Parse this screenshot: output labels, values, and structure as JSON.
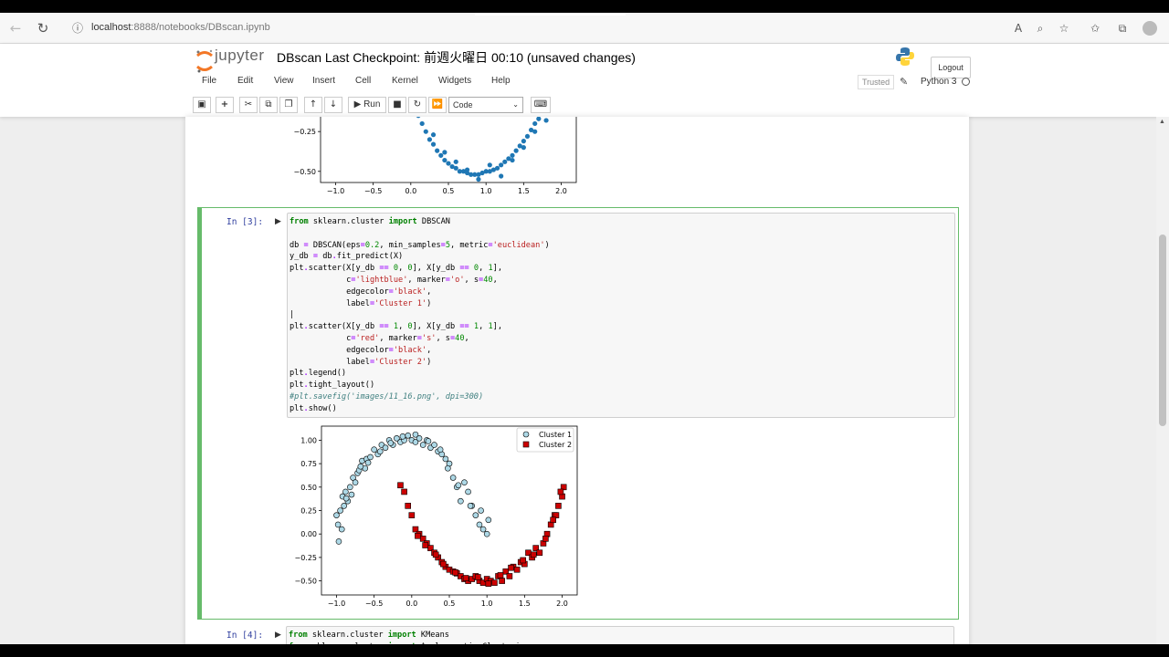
{
  "browser": {
    "url_host": "localhost",
    "url_rest": ":8888/notebooks/DBscan.ipynb"
  },
  "header": {
    "logo_text": "jupyter",
    "notebook_title": "DBscan Last Checkpoint: 前週火曜日 00:10  (unsaved changes)",
    "logout_label": "Logout",
    "trusted_label": "Trusted",
    "kernel_name": "Python 3"
  },
  "menu": {
    "items": [
      "File",
      "Edit",
      "View",
      "Insert",
      "Cell",
      "Kernel",
      "Widgets",
      "Help"
    ]
  },
  "toolbar": {
    "run_label": "Run",
    "cell_type": "Code"
  },
  "cells": {
    "cell3_prompt": "In [3]:",
    "cell4_prompt": "In [4]:",
    "cell4_line1": "from sklearn.cluster import KMeans",
    "cell4_line2": "from sklearn.cluster import AgglomerativeClustering"
  },
  "colors": {
    "accent_green": "#66bb6a",
    "prompt_blue": "#303f9f",
    "point_blue": "#1f77b4",
    "cluster1_fill": "#add8e6",
    "cluster2_fill": "#cc0000"
  },
  "chart_data": [
    {
      "type": "scatter",
      "xticks": [
        "−1.0",
        "−0.5",
        "0.0",
        "0.5",
        "1.0",
        "1.5",
        "2.0"
      ],
      "yticks": [
        "−0.25",
        "−0.50"
      ],
      "xlim": [
        -1.2,
        2.2
      ],
      "ylim": [
        -0.57,
        -0.1
      ],
      "note": "partially visible output of previous cell (lower moon)",
      "series": [
        {
          "color": "#1f77b4",
          "x": [
            0.1,
            0.15,
            0.2,
            0.25,
            0.3,
            0.35,
            0.4,
            0.45,
            0.5,
            0.55,
            0.6,
            0.65,
            0.7,
            0.75,
            0.8,
            0.85,
            0.9,
            0.95,
            1.0,
            1.05,
            1.1,
            1.15,
            1.2,
            1.25,
            1.3,
            1.35,
            1.4,
            1.45,
            1.5,
            1.55,
            1.6,
            1.65,
            1.7,
            1.75,
            1.8,
            1.85,
            1.9,
            0.3,
            0.45,
            0.6,
            0.75,
            0.9,
            1.05,
            1.2,
            1.35,
            1.5,
            1.65,
            1.8
          ],
          "y": [
            -0.15,
            -0.2,
            -0.25,
            -0.3,
            -0.33,
            -0.37,
            -0.4,
            -0.43,
            -0.45,
            -0.47,
            -0.48,
            -0.5,
            -0.5,
            -0.51,
            -0.52,
            -0.52,
            -0.52,
            -0.51,
            -0.5,
            -0.5,
            -0.49,
            -0.48,
            -0.46,
            -0.44,
            -0.42,
            -0.4,
            -0.37,
            -0.34,
            -0.31,
            -0.28,
            -0.24,
            -0.2,
            -0.17,
            -0.14,
            -0.12,
            -0.13,
            -0.11,
            -0.27,
            -0.38,
            -0.44,
            -0.49,
            -0.55,
            -0.46,
            -0.53,
            -0.43,
            -0.35,
            -0.25,
            -0.18
          ]
        }
      ]
    },
    {
      "type": "scatter",
      "xticks": [
        "−1.0",
        "−0.5",
        "0.0",
        "0.5",
        "1.0",
        "1.5",
        "2.0"
      ],
      "yticks": [
        "1.00",
        "0.75",
        "0.50",
        "0.25",
        "0.00",
        "−0.25",
        "−0.50"
      ],
      "xlim": [
        -1.2,
        2.2
      ],
      "ylim": [
        -0.65,
        1.15
      ],
      "legend": "top-right",
      "series": [
        {
          "name": "Cluster 1",
          "marker": "o",
          "color": "#add8e6",
          "x": [
            -1.0,
            -0.98,
            -0.95,
            -0.97,
            -0.92,
            -0.9,
            -0.88,
            -0.85,
            -0.82,
            -0.8,
            -0.78,
            -0.75,
            -0.72,
            -0.7,
            -0.66,
            -0.62,
            -0.6,
            -0.55,
            -0.5,
            -0.45,
            -0.4,
            -0.35,
            -0.3,
            -0.25,
            -0.2,
            -0.15,
            -0.1,
            -0.05,
            0.0,
            0.05,
            0.1,
            0.15,
            0.2,
            0.25,
            0.3,
            0.35,
            0.4,
            0.45,
            0.5,
            0.55,
            0.6,
            0.65,
            0.7,
            0.75,
            0.8,
            0.85,
            0.9,
            0.95,
            1.0,
            1.02,
            -0.93,
            -0.87,
            -0.68,
            -0.58,
            -0.42,
            -0.28,
            -0.12,
            0.05,
            0.22,
            0.38,
            0.48,
            0.62,
            0.78,
            0.92
          ],
          "y": [
            0.2,
            0.1,
            0.25,
            -0.08,
            0.4,
            0.3,
            0.45,
            0.35,
            0.5,
            0.42,
            0.6,
            0.55,
            0.65,
            0.68,
            0.78,
            0.7,
            0.8,
            0.82,
            0.9,
            0.85,
            0.95,
            0.92,
            1.0,
            0.95,
            1.02,
            0.98,
            1.0,
            1.05,
            1.0,
            0.98,
            1.02,
            0.95,
            1.0,
            0.92,
            0.95,
            0.88,
            0.85,
            0.8,
            0.75,
            0.6,
            0.5,
            0.35,
            0.55,
            0.45,
            0.3,
            0.2,
            0.1,
            0.05,
            0.0,
            0.15,
            0.05,
            0.38,
            0.72,
            0.76,
            0.88,
            0.97,
            1.04,
            1.06,
            0.99,
            0.9,
            0.7,
            0.52,
            0.3,
            0.25
          ]
        },
        {
          "name": "Cluster 2",
          "marker": "s",
          "color": "#cc0000",
          "x": [
            -0.15,
            -0.1,
            -0.05,
            0.0,
            0.05,
            0.1,
            0.15,
            0.2,
            0.25,
            0.3,
            0.35,
            0.4,
            0.45,
            0.5,
            0.55,
            0.6,
            0.65,
            0.7,
            0.75,
            0.8,
            0.85,
            0.9,
            0.95,
            1.0,
            1.05,
            1.1,
            1.15,
            1.2,
            1.25,
            1.3,
            1.35,
            1.4,
            1.45,
            1.5,
            1.55,
            1.6,
            1.65,
            1.7,
            1.75,
            1.8,
            1.85,
            1.9,
            1.95,
            2.0,
            2.02,
            1.98,
            1.92,
            0.08,
            0.18,
            0.32,
            0.42,
            0.58,
            0.72,
            0.88,
            1.02,
            1.18,
            1.32,
            1.48,
            1.62,
            1.78,
            1.88
          ],
          "y": [
            0.52,
            0.45,
            0.3,
            0.2,
            0.05,
            0.0,
            -0.05,
            -0.1,
            -0.15,
            -0.2,
            -0.25,
            -0.3,
            -0.35,
            -0.38,
            -0.4,
            -0.42,
            -0.45,
            -0.48,
            -0.5,
            -0.48,
            -0.45,
            -0.5,
            -0.52,
            -0.48,
            -0.5,
            -0.52,
            -0.45,
            -0.5,
            -0.4,
            -0.45,
            -0.35,
            -0.38,
            -0.3,
            -0.32,
            -0.2,
            -0.25,
            -0.15,
            -0.2,
            -0.1,
            0.0,
            0.1,
            0.2,
            0.3,
            0.4,
            0.5,
            0.45,
            0.2,
            -0.02,
            -0.12,
            -0.22,
            -0.32,
            -0.41,
            -0.47,
            -0.46,
            -0.53,
            -0.44,
            -0.36,
            -0.28,
            -0.22,
            -0.05,
            0.15
          ]
        }
      ]
    }
  ]
}
